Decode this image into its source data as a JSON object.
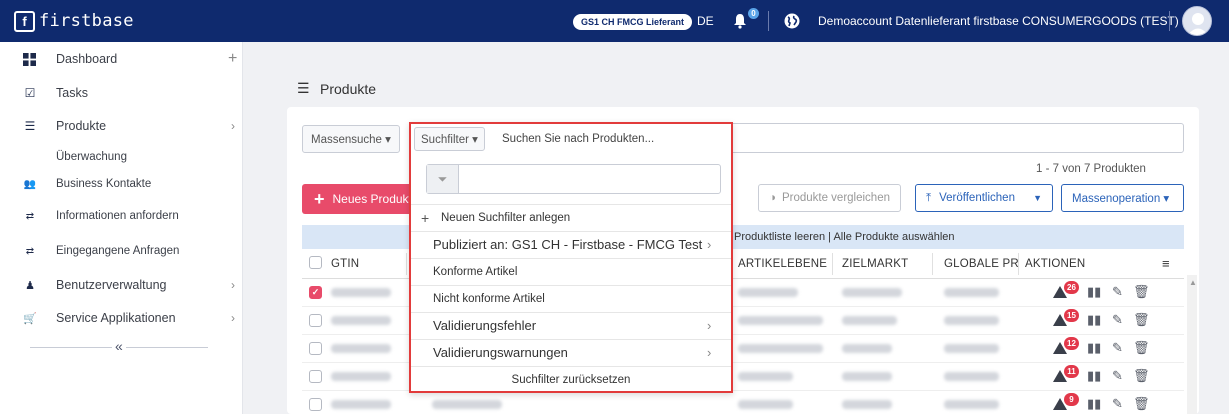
{
  "topbar": {
    "logo_mark": "f",
    "logo_text": "firstbase",
    "role_badge": "GS1 CH FMCG Lieferant",
    "language": "DE",
    "notification_count": "0",
    "account": "Demoaccount Datenlieferant firstbase CONSUMERGOODS (TEST)",
    "brand_color": "#0f2a6e"
  },
  "sidebar": {
    "items": [
      {
        "label": "Dashboard",
        "icon": "dashboard-grid-icon"
      },
      {
        "label": "Tasks",
        "icon": "checkbox-icon"
      },
      {
        "label": "Produkte",
        "icon": "list-icon"
      },
      {
        "label": "Überwachung",
        "icon": ""
      },
      {
        "label": "Business Kontakte",
        "icon": "users-icon"
      },
      {
        "label": "Informationen anfordern",
        "icon": "request-icon"
      },
      {
        "label": "Eingegangene Anfragen",
        "icon": "inbox-icon"
      },
      {
        "label": "Benutzerverwaltung",
        "icon": "user-admin-icon"
      },
      {
        "label": "Service Applikationen",
        "icon": "cart-icon"
      }
    ],
    "collapse_glyph": "«"
  },
  "page": {
    "title": "Produkte"
  },
  "toolbar": {
    "mass_search": "Massensuche ▾",
    "search_filter": "Suchfilter ▾",
    "search_placeholder": "Suchen Sie nach Produkten...",
    "count": "1 - 7 von 7 Produkten",
    "new_product": "Neues Produkt",
    "compare": "Produkte vergleichen",
    "publish": "Veröffentlichen",
    "mass_operation": "Massenoperation ▾"
  },
  "table": {
    "bar_text": "Produktliste leeren  |  Alle Produkte auswählen",
    "headers": {
      "gtin": "GTIN",
      "level": "ARTIKELEBENE",
      "target_market": "ZIELMARKT",
      "global": "GLOBALE PR",
      "actions": "AKTIONEN"
    },
    "rows": [
      {
        "checked": true,
        "warnings": "26"
      },
      {
        "checked": false,
        "warnings": "15"
      },
      {
        "checked": false,
        "warnings": "12"
      },
      {
        "checked": false,
        "warnings": "11"
      },
      {
        "checked": false,
        "warnings": "9"
      }
    ]
  },
  "dropdown": {
    "new_filter": "Neuen Suchfilter anlegen",
    "items": [
      {
        "label": "Publiziert an: GS1 CH - Firstbase - FMCG Test",
        "arrow": true,
        "big": true
      },
      {
        "label": "Konforme Artikel",
        "arrow": false,
        "big": false
      },
      {
        "label": "Nicht konforme Artikel",
        "arrow": false,
        "big": false
      },
      {
        "label": "Validierungsfehler",
        "arrow": true,
        "big": true
      },
      {
        "label": "Validierungswarnungen",
        "arrow": true,
        "big": true
      }
    ],
    "reset": "Suchfilter zurücksetzen",
    "highlight_color": "#e23b3b"
  }
}
